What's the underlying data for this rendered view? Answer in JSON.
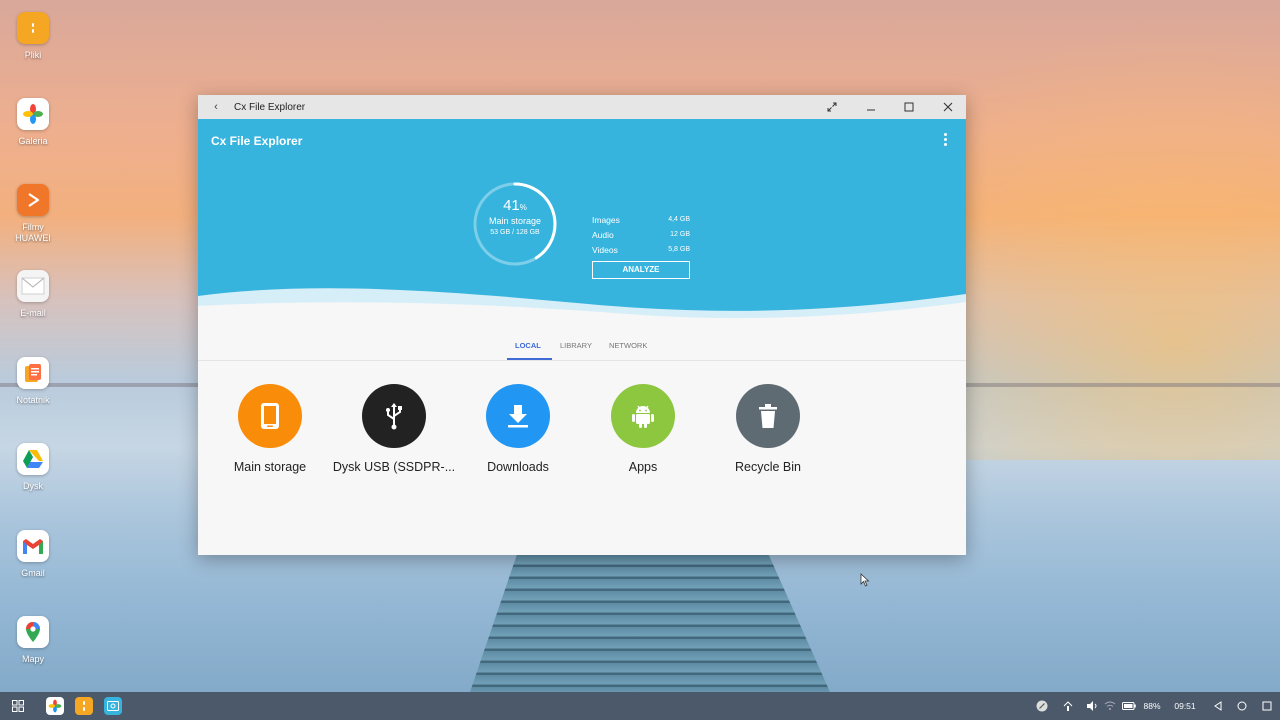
{
  "desktop": {
    "icons": [
      {
        "label": "Pliki",
        "icon": "files-icon",
        "color": "#f5a623"
      },
      {
        "label": "Galeria",
        "icon": "gallery-icon",
        "color": "#ffffff"
      },
      {
        "label": "Filmy\nHUAWEI",
        "icon": "video-play-icon",
        "color": "#f0762a"
      },
      {
        "label": "E-mail",
        "icon": "envelope-icon",
        "color": "#f4f4f4"
      },
      {
        "label": "Notatnik",
        "icon": "notepad-icon",
        "color": "#f6a623"
      },
      {
        "label": "Dysk",
        "icon": "google-drive-icon",
        "color": "#ffffff"
      },
      {
        "label": "Gmail",
        "icon": "gmail-icon",
        "color": "#ffffff"
      },
      {
        "label": "Mapy",
        "icon": "maps-pin-icon",
        "color": "#ffffff"
      }
    ]
  },
  "window": {
    "title": "Cx File Explorer",
    "app_title": "Cx File Explorer",
    "accent_color": "#36b4de",
    "storage": {
      "percent": "41",
      "percent_sign": "%",
      "label": "Main storage",
      "usage": "53 GB / 128 GB",
      "fill_fraction": 0.41
    },
    "stats": [
      {
        "label": "Images",
        "value": "4,4 GB"
      },
      {
        "label": "Audio",
        "value": "12 GB"
      },
      {
        "label": "Videos",
        "value": "5,8 GB"
      }
    ],
    "analyze_label": "ANALYZE",
    "tabs": {
      "local": "LOCAL",
      "library": "LIBRARY",
      "network": "NETWORK"
    },
    "items": [
      {
        "name": "Main storage",
        "icon": "tablet-icon",
        "color": "#f98d0a"
      },
      {
        "name": "Dysk USB (SSDPR-...",
        "icon": "usb-icon",
        "color": "#222222"
      },
      {
        "name": "Downloads",
        "icon": "download-icon",
        "color": "#2196f3"
      },
      {
        "name": "Apps",
        "icon": "android-icon",
        "color": "#8dc63f"
      },
      {
        "name": "Recycle Bin",
        "icon": "trash-icon",
        "color": "#5f6b73"
      }
    ]
  },
  "taskbar": {
    "battery": "88%",
    "time": "09:51"
  }
}
